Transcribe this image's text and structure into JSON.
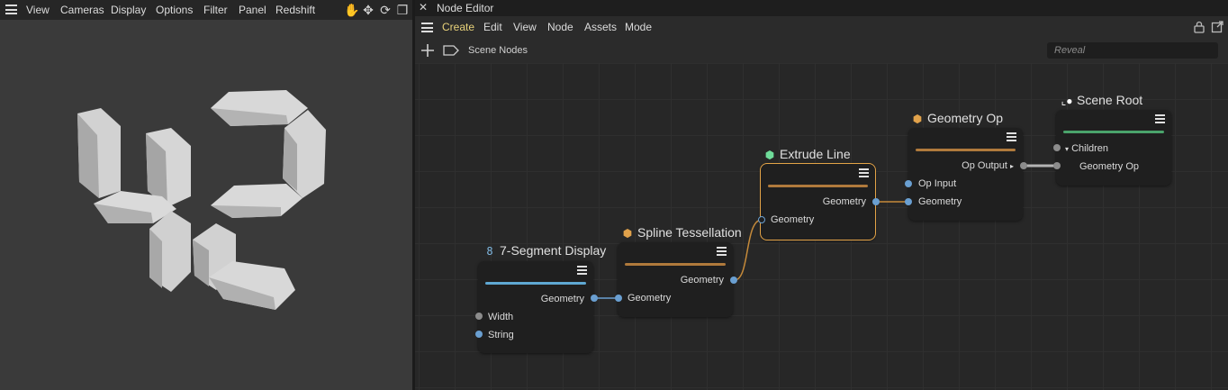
{
  "viewport": {
    "menu": [
      "View",
      "Cameras",
      "Display",
      "Options",
      "Filter",
      "Panel",
      "Redshift"
    ],
    "tools": [
      {
        "icon": "hand-pan-icon",
        "glyph": "✋"
      },
      {
        "icon": "move-arrows-icon",
        "glyph": "✥"
      },
      {
        "icon": "rotate-icon",
        "glyph": "⟳"
      },
      {
        "icon": "maximize-view-icon",
        "glyph": "❐"
      }
    ],
    "display_digits": "42"
  },
  "node_editor": {
    "title": "Node Editor",
    "menu": [
      "Create",
      "Edit",
      "View",
      "Node",
      "Assets",
      "Mode"
    ],
    "active_menu": "Create",
    "breadcrumb": "Scene Nodes",
    "search_placeholder": "Reveal",
    "nodes": {
      "seven_seg": {
        "title": "7-Segment Display",
        "color": "#5fa8d3",
        "outputs": [
          "Geometry"
        ],
        "inputs": [
          "Width",
          "String"
        ]
      },
      "spline_tess": {
        "title": "Spline Tessellation",
        "color": "#b07a3c",
        "inputs": [
          "Geometry"
        ],
        "outputs": [
          "Geometry"
        ]
      },
      "extrude_line": {
        "title": "Extrude Line",
        "color": "#b07a3c",
        "outputs": [
          "Geometry"
        ],
        "inputs": [
          "Geometry"
        ]
      },
      "geometry_op": {
        "title": "Geometry Op",
        "color": "#b07a3c",
        "outputs": [
          "Op Output"
        ],
        "inputs": [
          "Op Input",
          "Geometry"
        ]
      },
      "scene_root": {
        "title": "Scene Root",
        "color": "#4aa36b",
        "inputs": [
          "Children",
          "Geometry Op"
        ]
      }
    },
    "colors": {
      "accent_active_menu": "#e8d27a",
      "wire_orange": "#c58a3a",
      "wire_blue": "#6a9fd1",
      "wire_gray": "#b5b5b5"
    }
  }
}
